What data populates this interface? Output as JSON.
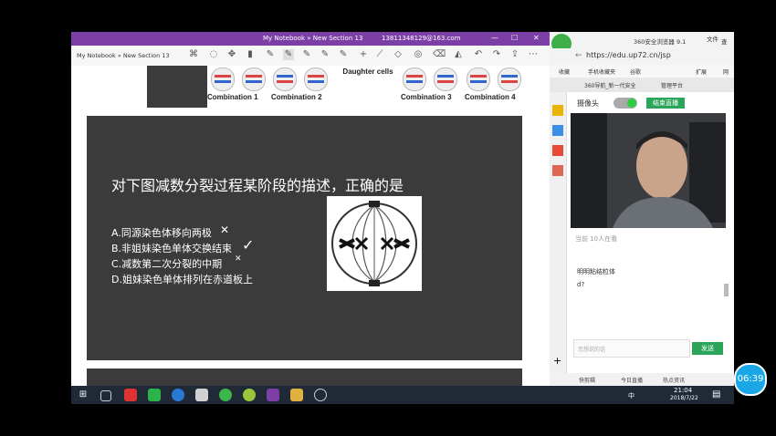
{
  "onenote": {
    "title": "My Notebook » New Section 13",
    "email": "13811348129@163.com",
    "breadcrumb": "My Notebook » New Section 13",
    "window_controls": [
      "—",
      "☐",
      "✕"
    ]
  },
  "top_slide": {
    "labels": [
      "Combination 1",
      "Combination 2",
      "Combination 3",
      "Combination 4"
    ],
    "daughter": "Daughter cells"
  },
  "question": {
    "title": "对下图减数分裂过程某阶段的描述，正确的是",
    "options": [
      "A.同源染色体移向两极",
      "B.非姐妹染色单体交换结束",
      "C.减数第二次分裂的中期",
      "D.姐妹染色单体排列在赤道板上"
    ],
    "marks": [
      "✕",
      "✓",
      "✕",
      ""
    ]
  },
  "browser": {
    "title": "360安全浏览器 9.1",
    "title_right": [
      "文件",
      "查"
    ],
    "url": "https://edu.up72.cn/jsp",
    "bookmarks": [
      "收藏",
      "手机收藏夹",
      "谷歌",
      "扩展",
      "网"
    ],
    "tabs": [
      "360导航_新一代安全",
      "管理平台"
    ],
    "camera_label": "摄像头",
    "end_live": "结束直播",
    "viewers": "当前 10人在看",
    "chat": [
      "明明粘结粒体",
      "d?"
    ],
    "input_placeholder": "您想说的话",
    "send": "发送",
    "statusbar": [
      "快剪辑",
      "今日直播",
      "热点资讯"
    ]
  },
  "taskbar": {
    "clock": "21:04",
    "date": "2018/7/22",
    "ime": "中"
  },
  "timer": "06:39",
  "colors": {
    "onenote_purple": "#7b3fa6",
    "slide_bg": "#3b3b3b",
    "green": "#2aa55a",
    "timer_blue": "#1aa7e8"
  }
}
